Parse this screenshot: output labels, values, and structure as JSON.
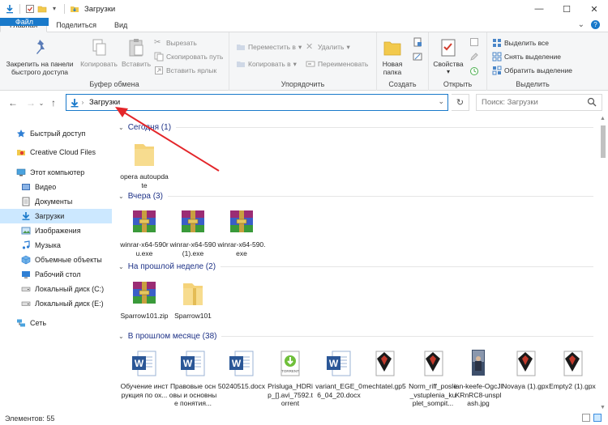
{
  "window": {
    "title": "Загрузки",
    "controls": {
      "minimize": "—",
      "maximize": "☐",
      "close": "✕"
    }
  },
  "tabs": [
    {
      "label": "Файл"
    },
    {
      "label": "Главная"
    },
    {
      "label": "Поделиться"
    },
    {
      "label": "Вид"
    }
  ],
  "ribbon": {
    "clipboard": {
      "label": "Буфер обмена",
      "pin": "Закрепить на панели быстрого доступа",
      "copy": "Копировать",
      "paste": "Вставить",
      "cut": "Вырезать",
      "copy_path": "Скопировать путь",
      "paste_shortcut": "Вставить ярлык"
    },
    "organize": {
      "label": "Упорядочить",
      "move_to": "Переместить в",
      "copy_to": "Копировать в",
      "delete": "Удалить",
      "rename": "Переименовать"
    },
    "create": {
      "label": "Создать",
      "new_folder": "Новая папка"
    },
    "open": {
      "label": "Открыть",
      "properties": "Свойства"
    },
    "select": {
      "label": "Выделить",
      "select_all": "Выделить все",
      "select_none": "Снять выделение",
      "invert": "Обратить выделение"
    }
  },
  "address": {
    "path": "Загрузки",
    "search_placeholder": "Поиск: Загрузки"
  },
  "sidebar": {
    "items": [
      {
        "label": "Быстрый доступ",
        "icon": "star-icon"
      },
      {
        "label": "Creative Cloud Files",
        "icon": "creative-cloud-icon"
      },
      {
        "label": "Этот компьютер",
        "icon": "computer-icon"
      },
      {
        "label": "Видео",
        "icon": "video-folder-icon"
      },
      {
        "label": "Документы",
        "icon": "documents-folder-icon"
      },
      {
        "label": "Загрузки",
        "icon": "downloads-folder-icon"
      },
      {
        "label": "Изображения",
        "icon": "pictures-folder-icon"
      },
      {
        "label": "Музыка",
        "icon": "music-folder-icon"
      },
      {
        "label": "Объемные объекты",
        "icon": "3d-objects-icon"
      },
      {
        "label": "Рабочий стол",
        "icon": "desktop-folder-icon"
      },
      {
        "label": "Локальный диск (C:)",
        "icon": "drive-icon"
      },
      {
        "label": "Локальный диск (E:)",
        "icon": "drive-icon"
      },
      {
        "label": "Сеть",
        "icon": "network-icon"
      }
    ]
  },
  "groups": [
    {
      "header": "Сегодня (1)",
      "files": [
        {
          "name": "opera autoupdate",
          "icon": "folder-icon"
        }
      ]
    },
    {
      "header": "Вчера (3)",
      "files": [
        {
          "name": "winrar-x64-590ru.exe",
          "icon": "winrar-icon"
        },
        {
          "name": "winrar-x64-590 (1).exe",
          "icon": "winrar-icon"
        },
        {
          "name": "winrar-x64-590.exe",
          "icon": "winrar-icon"
        }
      ]
    },
    {
      "header": "На прошлой неделе (2)",
      "files": [
        {
          "name": "Sparrow101.zip",
          "icon": "winrar-icon"
        },
        {
          "name": "Sparrow101",
          "icon": "folder-icon"
        }
      ]
    },
    {
      "header": "В прошлом месяце (38)",
      "files": [
        {
          "name": "Обучение инструкция по ох...",
          "icon": "word-icon"
        },
        {
          "name": "Правовые основы и основные понятия...",
          "icon": "word-icon"
        },
        {
          "name": "50240515.docx",
          "icon": "word-icon"
        },
        {
          "name": "Prisluga_HDRip_[].avi_7592.torrent",
          "icon": "torrent-icon"
        },
        {
          "name": "variant_EGE_06_04_20.docx",
          "icon": "word-icon"
        },
        {
          "name": "mechtatel.gp5",
          "icon": "guitar-pro-icon"
        },
        {
          "name": "Norm_riff_posle_vstuplenia_kuplet_sompit...",
          "icon": "guitar-pro-icon"
        },
        {
          "name": "ian-keefe-OgcJIKRnRC8-unsplash.jpg",
          "icon": "image-file-icon"
        },
        {
          "name": "Novaya (1).gpx",
          "icon": "guitar-pro-icon"
        },
        {
          "name": "Empty2 (1).gpx",
          "icon": "guitar-pro-icon"
        }
      ]
    }
  ],
  "status": {
    "items_count": "Элементов: 55"
  },
  "colors": {
    "accent": "#1979ca",
    "group_header": "#1e3287",
    "selection": "#cce8ff",
    "annotation": "#e3262a"
  }
}
